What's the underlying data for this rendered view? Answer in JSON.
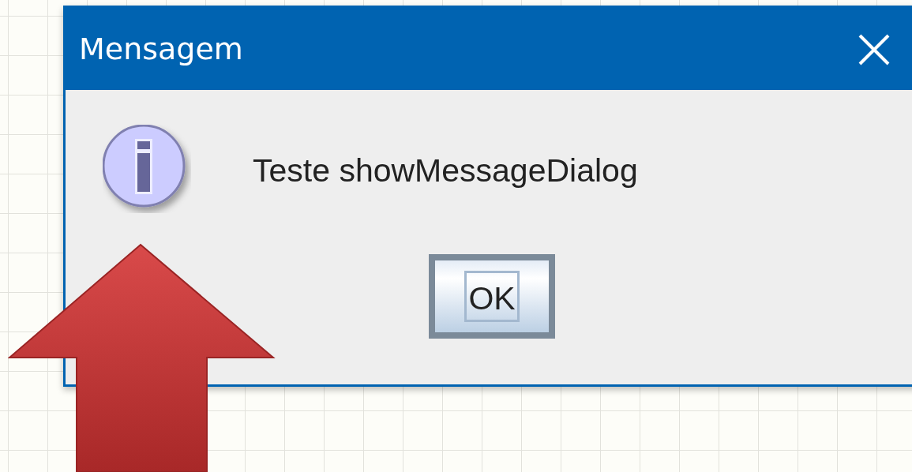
{
  "dialog": {
    "title": "Mensagem",
    "message": "Teste showMessageDialog",
    "buttons": [
      {
        "label": "OK",
        "focused": true
      }
    ]
  }
}
